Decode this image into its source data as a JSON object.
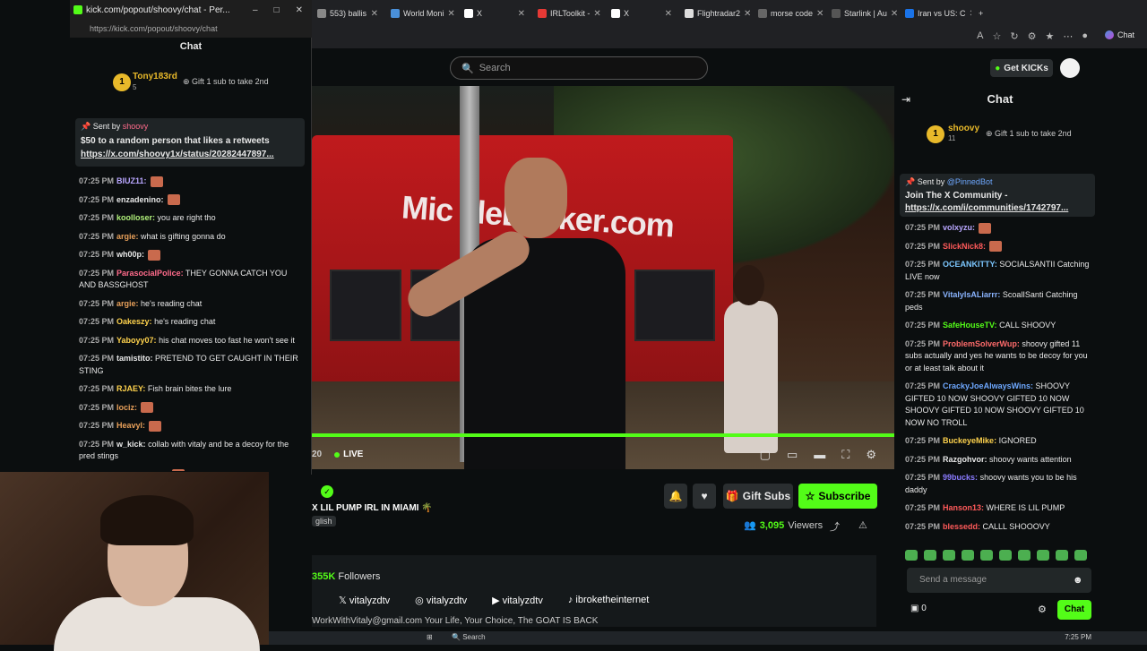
{
  "browser_tabs": [
    {
      "label": "553) ballis",
      "icon": "tab-icon",
      "color": "#888888"
    },
    {
      "label": "World Moni",
      "icon": "globe-icon",
      "color": "#4a90d9"
    },
    {
      "label": "X",
      "icon": "x-icon",
      "color": "#ffffff"
    },
    {
      "label": "IRLToolkit -",
      "icon": "irl-icon",
      "color": "#e53935"
    },
    {
      "label": "X",
      "icon": "x-icon",
      "color": "#ffffff"
    },
    {
      "label": "Flightradar2",
      "icon": "plane-icon",
      "color": "#dddddd"
    },
    {
      "label": "morse code",
      "icon": "morse-icon",
      "color": "#666666"
    },
    {
      "label": "Starlink | Au",
      "icon": "starlink-icon",
      "color": "#555555"
    },
    {
      "label": "Iran vs US: C",
      "icon": "news-icon",
      "color": "#1a73e8"
    }
  ],
  "browser_chat_label": "Chat",
  "search_placeholder": "Search",
  "get_kicks_label": "Get KICKs",
  "player": {
    "time": "20",
    "live_label": "LIVE"
  },
  "stream": {
    "title": "X LIL PUMP IRL IN MIAMI 🌴",
    "language": "glish",
    "gift_subs_label": "Gift Subs",
    "subscribe_label": "Subscribe",
    "viewers_count": "3,095",
    "viewers_label": "Viewers"
  },
  "about": {
    "followers_count": "355K",
    "followers_label": "Followers",
    "socials": [
      {
        "platform": "x-icon",
        "handle": "vitalyzdtv"
      },
      {
        "platform": "instagram-icon",
        "handle": "vitalyzdtv"
      },
      {
        "platform": "youtube-icon",
        "handle": "vitalyzdtv"
      },
      {
        "platform": "tiktok-icon",
        "handle": "ibroketheinternet"
      }
    ],
    "bio": "WorkWithVitaly@gmail.com Your Life, Your Choice, The GOAT IS BACK"
  },
  "right_chat": {
    "title": "Chat",
    "top_gifter": {
      "rank": "1",
      "name": "shoovy",
      "count": "11"
    },
    "gift_prompt": "Gift 1 sub to take 2nd",
    "pinned": {
      "sent_by": "Sent by",
      "user": "@PinnedBot",
      "text": "Join The X Community -",
      "link": "https://x.com/i/communities/1742797..."
    },
    "messages": [
      {
        "time": "07:25 PM",
        "user": "volxyzu",
        "color": "#b9a7ff",
        "text": ""
      },
      {
        "time": "07:25 PM",
        "user": "SlickNick8",
        "color": "#ff5a5a",
        "text": ""
      },
      {
        "time": "07:25 PM",
        "user": "OCEANKITTY",
        "color": "#7cc7ff",
        "text": "SOCIALSANTII Catching LIVE now"
      },
      {
        "time": "07:25 PM",
        "user": "VitalylsALiarrr",
        "color": "#8ab4ff",
        "text": "ScoalISanti Catching peds"
      },
      {
        "time": "07:25 PM",
        "user": "SafeHouseTV",
        "color": "#53fc18",
        "text": "CALL SHOOVY"
      },
      {
        "time": "07:25 PM",
        "user": "ProblemSolverWup",
        "color": "#ff6b6b",
        "text": "shoovy gifted 11 subs actually and yes he wants to be decoy for you or at least talk about it"
      },
      {
        "time": "07:25 PM",
        "user": "CrackyJoeAlwaysWins",
        "color": "#6ea8ff",
        "text": "SHOOVY GIFTED 10 NOW SHOOVY GIFTED 10 NOW SHOOVY GIFTED 10 NOW SHOOVY GIFTED 10 NOW NO TROLL"
      },
      {
        "time": "07:25 PM",
        "user": "BuckeyeMike",
        "color": "#ffd34d",
        "text": "IGNORED"
      },
      {
        "time": "07:25 PM",
        "user": "Razgohvor",
        "color": "#e8e8e8",
        "text": "shoovy wants attention"
      },
      {
        "time": "07:25 PM",
        "user": "99bucks",
        "color": "#8a7bff",
        "text": "shoovy wants you to be his daddy"
      },
      {
        "time": "07:25 PM",
        "user": "Hanson13",
        "color": "#ff5a5a",
        "text": "WHERE IS LIL PUMP"
      },
      {
        "time": "07:25 PM",
        "user": "blessedd",
        "color": "#ff5a5a",
        "text": "CALLL SHOOOVY"
      }
    ],
    "send_placeholder": "Send a message",
    "points": "0",
    "chat_button": "Chat"
  },
  "popup": {
    "window_title": "kick.com/popout/shoovy/chat - Per...",
    "url": "https://kick.com/popout/shoovy/chat",
    "chat_title": "Chat",
    "top_gifter": {
      "rank": "1",
      "name": "Tony183rd",
      "count": "5"
    },
    "gift_prompt": "Gift 1 sub to take 2nd",
    "pinned": {
      "sent_by": "Sent by",
      "user": "shoovy",
      "text": "$50 to a random person that likes a retweets",
      "link": "https://x.com/shoovy1x/status/20282447897..."
    },
    "messages": [
      {
        "time": "07:25 PM",
        "user": "BIUZ11",
        "color": "#b9a7ff",
        "text": ""
      },
      {
        "time": "07:25 PM",
        "user": "enzadenino",
        "color": "#e8e8e8",
        "text": ""
      },
      {
        "time": "07:25 PM",
        "user": "koolloser",
        "color": "#b0f07a",
        "text": "you are right tho"
      },
      {
        "time": "07:25 PM",
        "user": "argie",
        "color": "#e8a05a",
        "text": "what is gifting gonna do"
      },
      {
        "time": "07:25 PM",
        "user": "wh00p",
        "color": "#e8e8e8",
        "text": ""
      },
      {
        "time": "07:25 PM",
        "user": "ParasocialPolice",
        "color": "#ff6b8b",
        "text": "THEY GONNA CATCH YOU AND BASSGHOST"
      },
      {
        "time": "07:25 PM",
        "user": "argie",
        "color": "#e8a05a",
        "text": "he's reading chat"
      },
      {
        "time": "07:25 PM",
        "user": "Oakeszy",
        "color": "#ffd34d",
        "text": "he's reading chat"
      },
      {
        "time": "07:25 PM",
        "user": "Yaboyy07",
        "color": "#ffd34d",
        "text": "his chat moves too fast he won't see it"
      },
      {
        "time": "07:25 PM",
        "user": "tamistito",
        "color": "#e8e8e8",
        "text": "PRETEND TO GET CAUGHT IN THEIR STING"
      },
      {
        "time": "07:25 PM",
        "user": "RJAEY",
        "color": "#ffd34d",
        "text": "Fish brain bites the lure"
      },
      {
        "time": "07:25 PM",
        "user": "Iociz",
        "color": "#e8a05a",
        "text": ""
      },
      {
        "time": "07:25 PM",
        "user": "Heavyl",
        "color": "#e8a05a",
        "text": ""
      },
      {
        "time": "07:25 PM",
        "user": "w_kick",
        "color": "#e8e8e8",
        "text": "collab with vitaly and be a decoy for the pred stings"
      },
      {
        "time": "07:25 PM",
        "user": "grand_upper",
        "color": "#ff5a5a",
        "text": ""
      }
    ]
  },
  "taskbar": {
    "search": "Search",
    "time": "7:25 PM"
  }
}
